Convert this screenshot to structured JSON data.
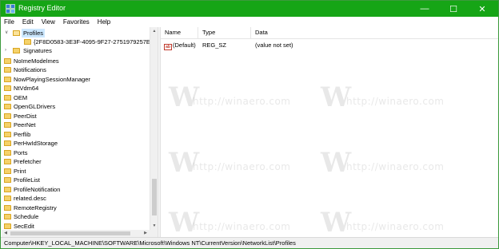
{
  "window": {
    "title": "Registry Editor",
    "accent_color": "#16a516",
    "icon": "registry-icon",
    "controls": {
      "minimize": "—",
      "maximize": "☐",
      "close": "✕"
    }
  },
  "menu": {
    "items": [
      "File",
      "Edit",
      "View",
      "Favorites",
      "Help"
    ]
  },
  "tree": {
    "selected_key": "Profiles",
    "expanded": {
      "label": "Profiles",
      "children": [
        "{2F8D0583-3E3F-4095-9F27-2751979257E6}"
      ]
    },
    "items": [
      "Signatures",
      "NoImeModelmes",
      "Notifications",
      "NowPlayingSessionManager",
      "NtVdm64",
      "OEM",
      "OpenGLDrivers",
      "PeerDist",
      "PeerNet",
      "Perflib",
      "PerHwIdStorage",
      "Ports",
      "Prefetcher",
      "Print",
      "ProfileList",
      "ProfileNotification",
      "related.desc",
      "RemoteRegistry",
      "Schedule",
      "SecEdit"
    ]
  },
  "list": {
    "columns": {
      "name": "Name",
      "type": "Type",
      "data": "Data"
    },
    "rows": [
      {
        "icon": "string-value-icon",
        "icon_text": "ab",
        "name": "(Default)",
        "type": "REG_SZ",
        "data": "(value not set)"
      }
    ]
  },
  "watermark": {
    "letter": "W",
    "text": "http://winaero.com"
  },
  "statusbar": {
    "path": "Computer\\HKEY_LOCAL_MACHINE\\SOFTWARE\\Microsoft\\Windows NT\\CurrentVersion\\NetworkList\\Profiles"
  }
}
